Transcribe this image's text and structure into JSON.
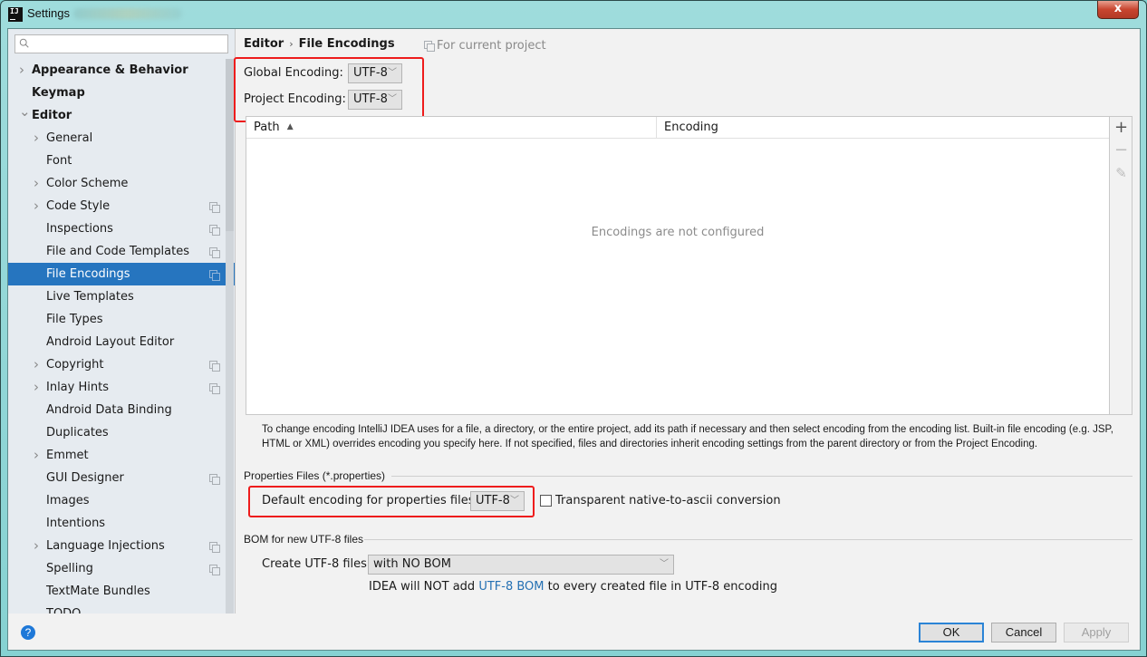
{
  "window": {
    "title": "Settings",
    "app_icon": "intellij-icon",
    "close_label": "x"
  },
  "sidebar": {
    "search": {
      "placeholder": "",
      "value": "",
      "icon": "search-icon"
    },
    "items": [
      {
        "label": "Appearance & Behavior",
        "level": 0,
        "expandable": true,
        "expanded": false,
        "project_scope": false
      },
      {
        "label": "Keymap",
        "level": 0,
        "expandable": false,
        "project_scope": false
      },
      {
        "label": "Editor",
        "level": 0,
        "expandable": true,
        "expanded": true,
        "project_scope": false
      },
      {
        "label": "General",
        "level": 1,
        "expandable": true,
        "project_scope": false
      },
      {
        "label": "Font",
        "level": 1,
        "expandable": false,
        "project_scope": false
      },
      {
        "label": "Color Scheme",
        "level": 1,
        "expandable": true,
        "project_scope": false
      },
      {
        "label": "Code Style",
        "level": 1,
        "expandable": true,
        "project_scope": true
      },
      {
        "label": "Inspections",
        "level": 1,
        "expandable": false,
        "project_scope": true
      },
      {
        "label": "File and Code Templates",
        "level": 1,
        "expandable": false,
        "project_scope": true
      },
      {
        "label": "File Encodings",
        "level": 1,
        "expandable": false,
        "project_scope": true,
        "selected": true
      },
      {
        "label": "Live Templates",
        "level": 1,
        "expandable": false,
        "project_scope": false
      },
      {
        "label": "File Types",
        "level": 1,
        "expandable": false,
        "project_scope": false
      },
      {
        "label": "Android Layout Editor",
        "level": 1,
        "expandable": false,
        "project_scope": false
      },
      {
        "label": "Copyright",
        "level": 1,
        "expandable": true,
        "project_scope": true
      },
      {
        "label": "Inlay Hints",
        "level": 1,
        "expandable": true,
        "project_scope": true
      },
      {
        "label": "Android Data Binding",
        "level": 1,
        "expandable": false,
        "project_scope": false
      },
      {
        "label": "Duplicates",
        "level": 1,
        "expandable": false,
        "project_scope": false
      },
      {
        "label": "Emmet",
        "level": 1,
        "expandable": true,
        "project_scope": false
      },
      {
        "label": "GUI Designer",
        "level": 1,
        "expandable": false,
        "project_scope": true
      },
      {
        "label": "Images",
        "level": 1,
        "expandable": false,
        "project_scope": false
      },
      {
        "label": "Intentions",
        "level": 1,
        "expandable": false,
        "project_scope": false
      },
      {
        "label": "Language Injections",
        "level": 1,
        "expandable": true,
        "project_scope": true
      },
      {
        "label": "Spelling",
        "level": 1,
        "expandable": false,
        "project_scope": true
      },
      {
        "label": "TextMate Bundles",
        "level": 1,
        "expandable": false,
        "project_scope": false
      },
      {
        "label": "TODO",
        "level": 1,
        "expandable": false,
        "project_scope": false
      }
    ]
  },
  "main": {
    "breadcrumb": {
      "parent": "Editor",
      "separator": "›",
      "current": "File Encodings"
    },
    "scope_note": "For current project",
    "global_encoding": {
      "label": "Global Encoding:",
      "value": "UTF-8"
    },
    "project_encoding": {
      "label": "Project Encoding:",
      "value": "UTF-8"
    },
    "table": {
      "columns": [
        {
          "label": "Path",
          "sort": "ascending",
          "sort_glyph": "▲"
        },
        {
          "label": "Encoding"
        }
      ],
      "rows": [],
      "empty_text": "Encodings are not configured",
      "tools": {
        "add": "+",
        "remove": "−",
        "edit": "✎"
      }
    },
    "help_text": "To change encoding IntelliJ IDEA uses for a file, a directory, or the entire project, add its path if necessary and then select encoding from the encoding list. Built-in file encoding (e.g. JSP, HTML or XML) overrides encoding you specify here. If not specified, files and directories inherit encoding settings from the parent directory or from the Project Encoding.",
    "properties_section": {
      "title": "Properties Files (*.properties)",
      "default_label": "Default encoding for properties files:",
      "default_value": "UTF-8",
      "native_to_ascii": {
        "label": "Transparent native-to-ascii conversion",
        "checked": false
      }
    },
    "bom_section": {
      "title": "BOM for new UTF-8 files",
      "create_label": "Create UTF-8 files:",
      "create_value": "with NO BOM",
      "note_prefix": "IDEA will NOT add ",
      "note_link": "UTF-8 BOM",
      "note_suffix": " to every created file in UTF-8 encoding"
    }
  },
  "footer": {
    "help": "?",
    "ok": "OK",
    "cancel": "Cancel",
    "apply": "Apply",
    "apply_enabled": false
  },
  "colors": {
    "selection": "#2675bf",
    "highlight_box": "#ee1c1c",
    "link": "#2470b3",
    "default_button_border": "#2b84d6"
  }
}
